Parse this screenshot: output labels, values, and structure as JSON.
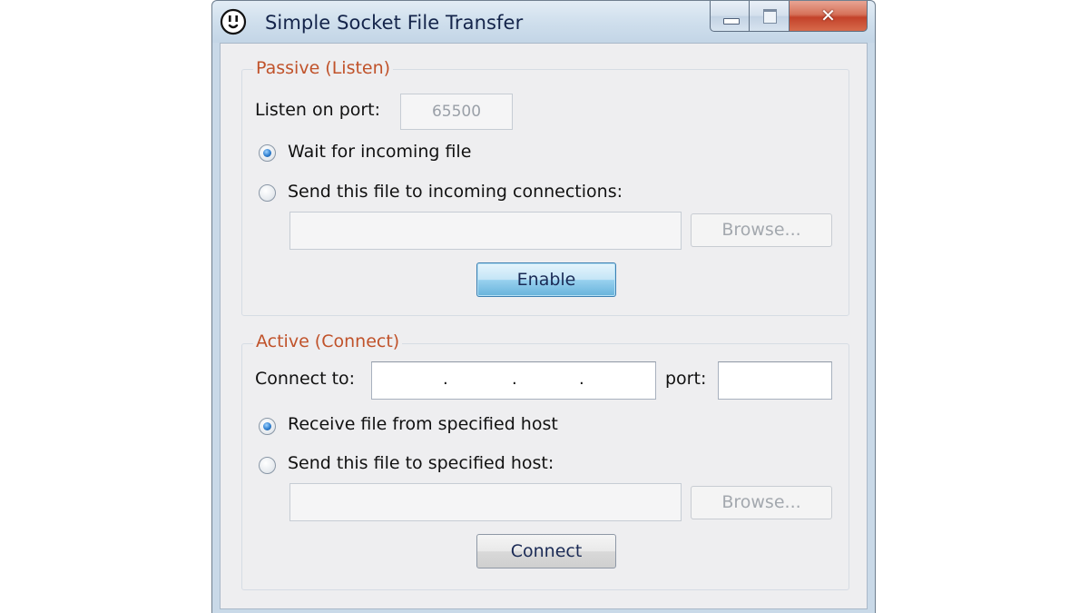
{
  "window": {
    "title": "Simple Socket File Transfer",
    "icon": "power-outlet-icon",
    "close_glyph": "✕"
  },
  "passive": {
    "group_title": "Passive (Listen)",
    "listen_port_label": "Listen on port:",
    "listen_port_value": "65500",
    "radio_wait_label": "Wait for incoming file",
    "radio_send_label": "Send this file to incoming connections:",
    "selected_radio": "wait",
    "file_path_value": "",
    "browse_label": "Browse...",
    "enable_label": "Enable"
  },
  "active": {
    "group_title": "Active (Connect)",
    "connect_to_label": "Connect to:",
    "ip_separators": [
      ".",
      ".",
      "."
    ],
    "port_label": "port:",
    "port_value": "",
    "radio_receive_label": "Receive file from specified host",
    "radio_send_label": "Send this file to specified host:",
    "selected_radio": "receive",
    "file_path_value": "",
    "browse_label": "Browse...",
    "connect_label": "Connect"
  },
  "colors": {
    "group_title": "#c0522a",
    "close_button": "#c3422a",
    "default_button": "#68b3db"
  }
}
